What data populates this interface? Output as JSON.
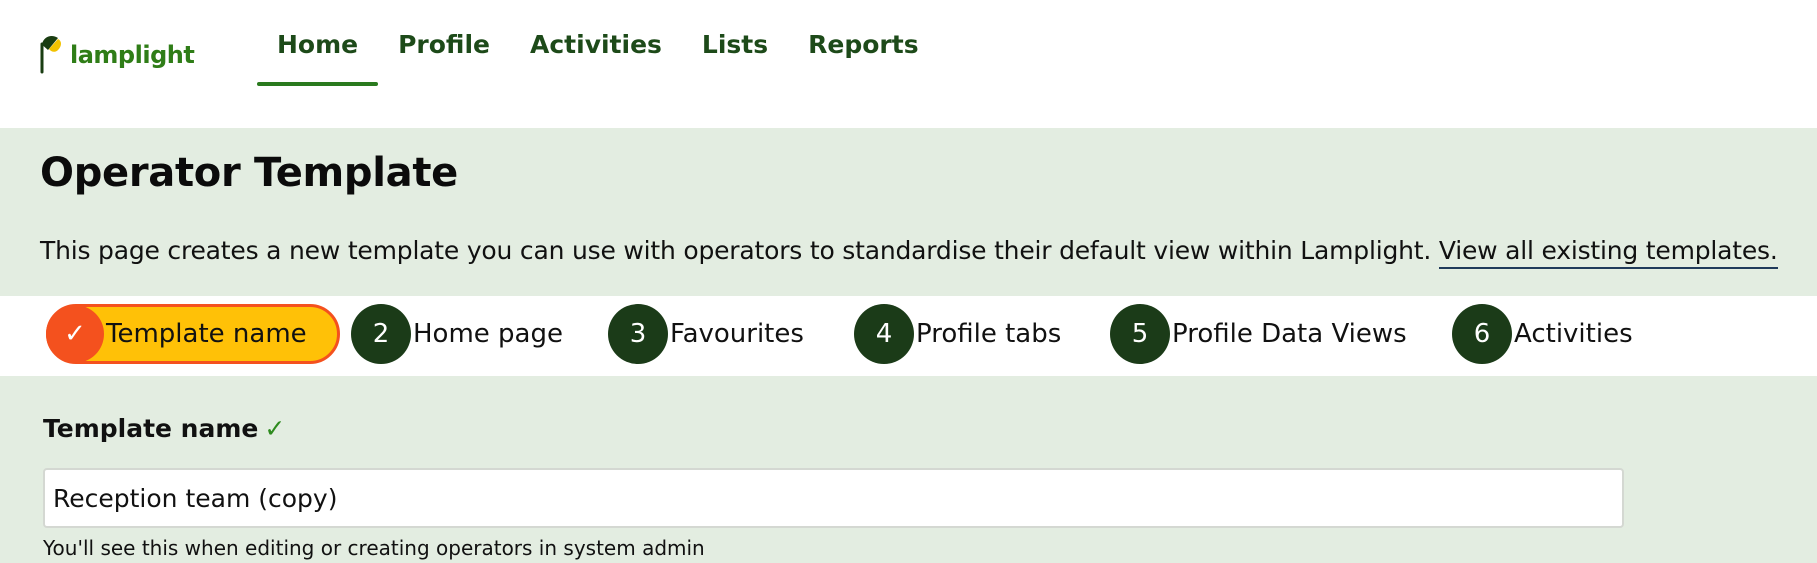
{
  "app": {
    "logo_text": "lamplight"
  },
  "nav": {
    "items": [
      {
        "label": "Home",
        "active": true
      },
      {
        "label": "Profile"
      },
      {
        "label": "Activities"
      },
      {
        "label": "Lists"
      },
      {
        "label": "Reports"
      }
    ]
  },
  "page": {
    "title": "Operator Template",
    "intro_text": "This page creates a new template you can use with operators to standardise their default view within Lamplight.",
    "intro_link": "View all existing templates."
  },
  "steps": [
    {
      "marker": "✓",
      "label": "Template name",
      "current": true
    },
    {
      "marker": "2",
      "label": "Home page"
    },
    {
      "marker": "3",
      "label": "Favourites"
    },
    {
      "marker": "4",
      "label": "Profile tabs"
    },
    {
      "marker": "5",
      "label": "Profile Data Views"
    },
    {
      "marker": "6",
      "label": "Activities"
    }
  ],
  "form": {
    "label": "Template name",
    "label_tick": "✓",
    "value": "Reception team (copy)",
    "help": "You'll see this when editing or creating operators in system admin"
  },
  "colors": {
    "brand_green": "#2f7d17",
    "nav_text": "#1d4a19",
    "banner_bg": "#e3ede1",
    "step_circle": "#1b3b18",
    "current_step_fill": "#ffc107",
    "current_step_accent": "#f4511e"
  },
  "icons": {
    "logo": "lamp-icon",
    "check": "check-icon"
  }
}
